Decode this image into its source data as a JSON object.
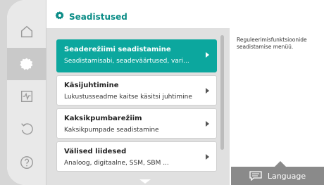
{
  "header": {
    "title": "Seadistused",
    "icon": "gear-icon"
  },
  "rail": {
    "items": [
      {
        "name": "home-icon"
      },
      {
        "name": "settings-icon",
        "active": true
      },
      {
        "name": "diagnostics-icon"
      },
      {
        "name": "restore-icon"
      },
      {
        "name": "help-icon"
      }
    ]
  },
  "menu": {
    "items": [
      {
        "title": "Seaderežiimi seadistamine",
        "subtitle": "Seadistamisabi, seadeväärtused, vari...",
        "selected": true
      },
      {
        "title": "Käsijuhtimine",
        "subtitle": "Lukustusseadme kaitse käsitsi juhtimine"
      },
      {
        "title": "Kaksikpumbarežiim",
        "subtitle": "Kaksikpumpade seadistamine"
      },
      {
        "title": "Välised liidesed",
        "subtitle": "Analoog, digitaalne, SSM, SBM ..."
      }
    ]
  },
  "info": {
    "description": "Reguleerimisfunktsioonide seadistamise menüü."
  },
  "language": {
    "label": "Language",
    "icon": "message-icon"
  },
  "colors": {
    "accent": "#0ca79e",
    "title": "#0a8c86",
    "rail": "#e9e9e9",
    "list_bg": "#e0e0e0",
    "language_bg": "#8a8a8a"
  }
}
